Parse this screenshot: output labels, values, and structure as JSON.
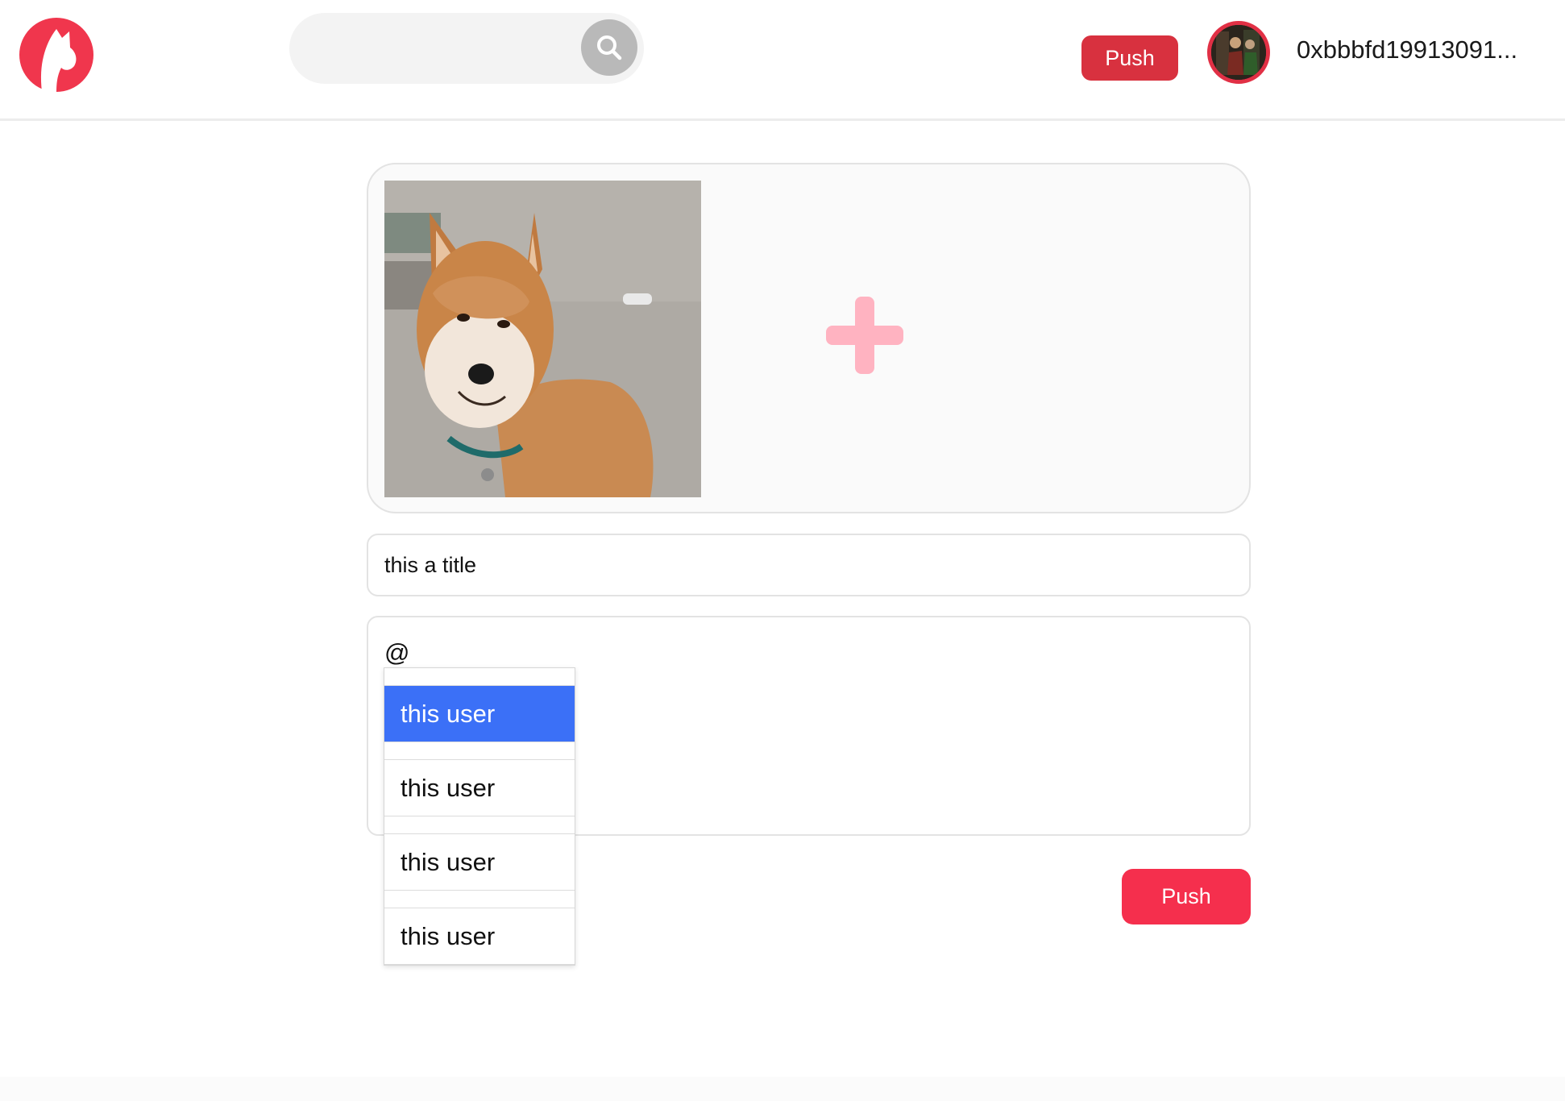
{
  "header": {
    "push_label": "Push",
    "account_address": "0xbbbfd19913091...",
    "avatar_icon": "avatar-image"
  },
  "search": {
    "placeholder": "",
    "icon": "search-icon"
  },
  "upload": {
    "image_icon": "shiba-inu-photo",
    "add_icon": "plus-icon"
  },
  "form": {
    "title_value": "this a title",
    "content_value": "@"
  },
  "mentions": {
    "items": [
      {
        "label": "this user",
        "selected": true
      },
      {
        "label": "this user",
        "selected": false
      },
      {
        "label": "this user",
        "selected": false
      },
      {
        "label": "this user",
        "selected": false
      }
    ]
  },
  "actions": {
    "push_label": "Push"
  },
  "colors": {
    "brand": "#f52f4d",
    "header_push": "#d8313f",
    "selected_option": "#3b70f7"
  }
}
